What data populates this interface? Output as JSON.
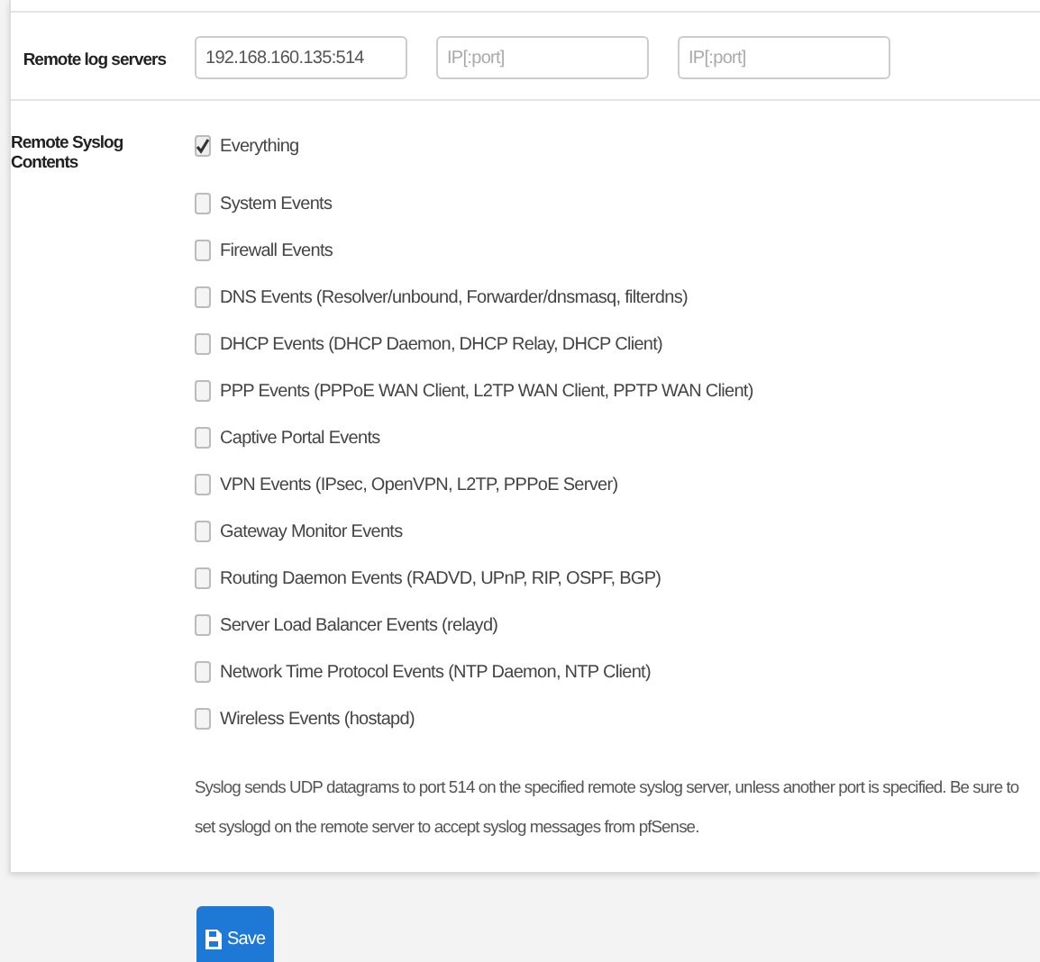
{
  "remote_log_servers": {
    "label": "Remote log servers",
    "fields": [
      {
        "value": "192.168.160.135:514"
      },
      {
        "placeholder": "IP[:port]"
      },
      {
        "placeholder": "IP[:port]"
      }
    ]
  },
  "remote_syslog_contents": {
    "label": "Remote Syslog Contents",
    "options": [
      {
        "label": "Everything",
        "checked": true
      },
      {
        "label": "System Events",
        "checked": false
      },
      {
        "label": "Firewall Events",
        "checked": false
      },
      {
        "label": "DNS Events (Resolver/unbound, Forwarder/dnsmasq, filterdns)",
        "checked": false
      },
      {
        "label": "DHCP Events (DHCP Daemon, DHCP Relay, DHCP Client)",
        "checked": false
      },
      {
        "label": "PPP Events (PPPoE WAN Client, L2TP WAN Client, PPTP WAN Client)",
        "checked": false
      },
      {
        "label": "Captive Portal Events",
        "checked": false
      },
      {
        "label": "VPN Events (IPsec, OpenVPN, L2TP, PPPoE Server)",
        "checked": false
      },
      {
        "label": "Gateway Monitor Events",
        "checked": false
      },
      {
        "label": "Routing Daemon Events (RADVD, UPnP, RIP, OSPF, BGP)",
        "checked": false
      },
      {
        "label": "Server Load Balancer Events (relayd)",
        "checked": false
      },
      {
        "label": "Network Time Protocol Events (NTP Daemon, NTP Client)",
        "checked": false
      },
      {
        "label": "Wireless Events (hostapd)",
        "checked": false
      }
    ],
    "help": "Syslog sends UDP datagrams to port 514 on the specified remote syslog server, unless another port is specified. Be sure to set syslogd on the remote server to accept syslog messages from pfSense."
  },
  "save_button": {
    "label": "Save"
  }
}
